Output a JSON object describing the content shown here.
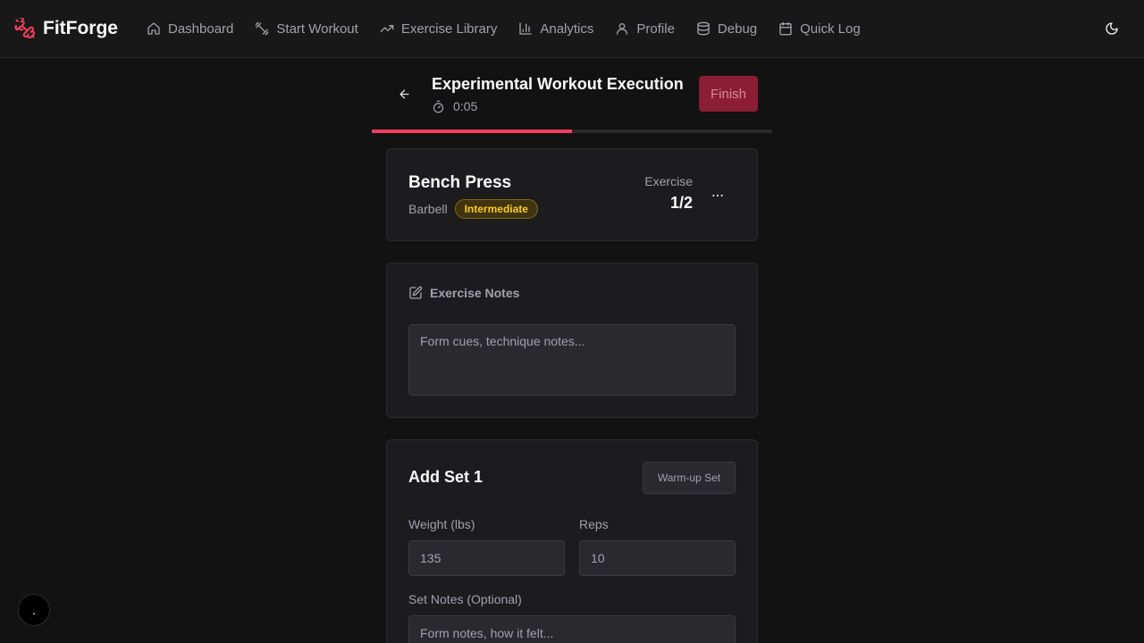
{
  "brand": {
    "name": "FitForge",
    "icon": "dumbbell-icon",
    "accent": "#f43f5e"
  },
  "nav": {
    "items": [
      {
        "label": "Dashboard",
        "icon": "home-icon"
      },
      {
        "label": "Start Workout",
        "icon": "dumbbell-icon"
      },
      {
        "label": "Exercise Library",
        "icon": "trending-up-icon"
      },
      {
        "label": "Analytics",
        "icon": "bar-chart-icon"
      },
      {
        "label": "Profile",
        "icon": "user-icon"
      },
      {
        "label": "Debug",
        "icon": "database-icon"
      },
      {
        "label": "Quick Log",
        "icon": "calendar-icon"
      }
    ],
    "theme_icon": "moon-icon"
  },
  "workout": {
    "title": "Experimental Workout Execution",
    "timer": "0:05",
    "finish_label": "Finish",
    "progress_fraction": 0.5
  },
  "exercise": {
    "name": "Bench Press",
    "equipment": "Barbell",
    "level": "Intermediate",
    "count_label": "Exercise",
    "count": "1/2"
  },
  "notes": {
    "title": "Exercise Notes",
    "placeholder": "Form cues, technique notes..."
  },
  "set_form": {
    "title": "Add Set 1",
    "warmup_label": "Warm-up Set",
    "weight_label": "Weight (lbs)",
    "weight_placeholder": "135",
    "reps_label": "Reps",
    "reps_placeholder": "10",
    "set_notes_label": "Set Notes (Optional)",
    "set_notes_placeholder": "Form notes, how it felt..."
  },
  "fab": {
    "label": "."
  }
}
